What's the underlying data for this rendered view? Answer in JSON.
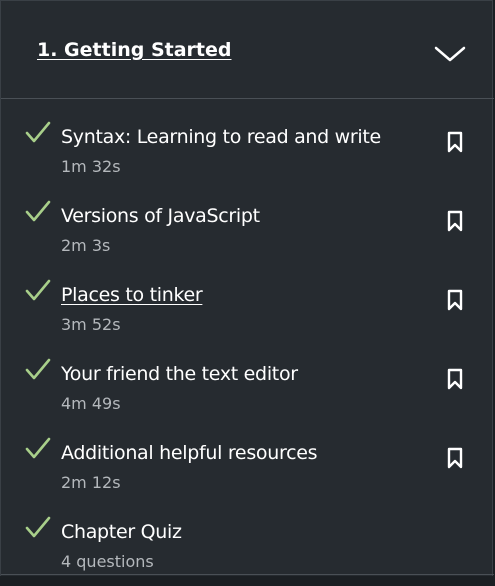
{
  "section": {
    "title": "1. Getting Started",
    "expanded": true
  },
  "colors": {
    "background": "#262b30",
    "check": "#a8cf8a",
    "text": "#ffffff",
    "meta": "#b4b8bc"
  },
  "items": [
    {
      "title": "Syntax: Learning to read and write",
      "meta": "1m 32s",
      "completed": true,
      "bookmark": true,
      "underlined": false
    },
    {
      "title": "Versions of JavaScript",
      "meta": "2m 3s",
      "completed": true,
      "bookmark": true,
      "underlined": false
    },
    {
      "title": "Places to tinker",
      "meta": "3m 52s",
      "completed": true,
      "bookmark": true,
      "underlined": true
    },
    {
      "title": "Your friend the text editor",
      "meta": "4m 49s",
      "completed": true,
      "bookmark": true,
      "underlined": false
    },
    {
      "title": "Additional helpful resources",
      "meta": "2m 12s",
      "completed": true,
      "bookmark": true,
      "underlined": false
    },
    {
      "title": "Chapter Quiz",
      "meta": "4 questions",
      "completed": true,
      "bookmark": false,
      "underlined": false
    }
  ]
}
